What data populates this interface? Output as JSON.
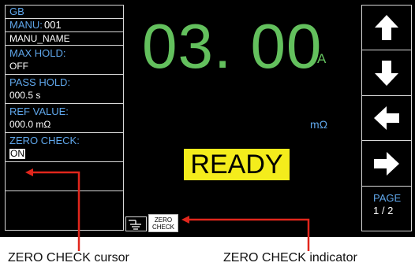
{
  "colors": {
    "label_blue": "#5fa6ea",
    "readout_green": "#63c05d",
    "ready_yellow": "#f4ec1c",
    "callout_red": "#e1261c"
  },
  "left_panel": {
    "header": "GB",
    "manu_label": "MANU:",
    "manu_number": "001",
    "manu_name": "MANU_NAME",
    "params": [
      {
        "label": "MAX HOLD:",
        "value": "OFF"
      },
      {
        "label": "PASS HOLD:",
        "value": "000.5 s"
      },
      {
        "label": "REF VALUE:",
        "value": "000.0 mΩ"
      },
      {
        "label": "ZERO CHECK:",
        "value": "ON"
      }
    ]
  },
  "readout": {
    "value": "03. 00",
    "unit": "A",
    "resistance_unit": "mΩ"
  },
  "status": "READY",
  "indicators": {
    "zero_check_line1": "ZERO",
    "zero_check_line2": "CHECK"
  },
  "softkeys": [
    {
      "icon": "arrow-up-icon"
    },
    {
      "icon": "arrow-down-icon"
    },
    {
      "icon": "arrow-left-icon"
    },
    {
      "icon": "arrow-right-icon"
    },
    {
      "label": "PAGE",
      "page": "1 / 2"
    }
  ],
  "callouts": {
    "cursor": "ZERO CHECK cursor",
    "indicator": "ZERO CHECK indicator"
  }
}
